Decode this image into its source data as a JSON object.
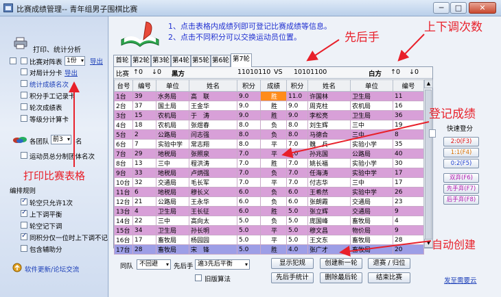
{
  "window": {
    "title": "比赛成绩管理-- 青年组男子围棋比赛",
    "minimize": "─",
    "maximize": "□",
    "close": "✕"
  },
  "sidebar": {
    "print_section_title": "打印、统计分析",
    "print_items": [
      {
        "label": "比赛对阵表",
        "checked": false,
        "copies": "1份",
        "action": "导出"
      },
      {
        "label": "对局计分卡",
        "checked": false,
        "action": "导出"
      },
      {
        "label": "统计成绩名次",
        "checked": false,
        "highlight": true
      },
      {
        "label": "积分手工记录卡",
        "checked": false
      },
      {
        "label": "轮次成绩表",
        "checked": false
      },
      {
        "label": "等级分计算卡",
        "checked": false
      }
    ],
    "team_label_before": "各团队",
    "team_select": "前3",
    "team_label_after": "名",
    "team_points_label": "运动员总分制团体名次",
    "rules_title": "编排规则",
    "rules": [
      {
        "label": "轮空只允许1次",
        "checked": true
      },
      {
        "label": "上下调平衡",
        "checked": true
      },
      {
        "label": "轮空记下调",
        "checked": false
      },
      {
        "label": "同积分仅一位时上下调不记",
        "checked": true
      },
      {
        "label": "包含辅助分",
        "checked": false
      }
    ],
    "update_link": "软件更新/论坛交流"
  },
  "instructions": {
    "line1": "1、点击表格内成绩列即可登记比赛成绩等信息。",
    "line2": "2、点击不同积分可以交换运动员位置。"
  },
  "annotations": {
    "order": "先后手",
    "updown": "上下调次数",
    "register": "登记成绩",
    "print": "打印比赛表格",
    "auto": "自动创建"
  },
  "tabs": [
    "首轮",
    "第2轮",
    "第3轮",
    "第4轮",
    "第5轮",
    "第6轮",
    "第7轮"
  ],
  "active_tab": "第7轮",
  "pair_bar": {
    "match_label": "比赛",
    "up_black": "↑0",
    "down_black": "↓0",
    "black_label": "黑方",
    "black_code": "11010110",
    "vs": "VS",
    "white_code": "10101100",
    "white_label": "白方",
    "up_white": "↑0",
    "down_white": "↓0"
  },
  "table": {
    "headers": [
      "台号",
      "编号",
      "单位",
      "姓名",
      "积分",
      "成绩",
      "积分",
      "姓名",
      "单位",
      "编号"
    ],
    "rows": [
      {
        "style": "pink",
        "cells": [
          "1台",
          "39",
          "水务局",
          "高　联",
          "9.0",
          "胜",
          "11.0",
          "许国林",
          "卫生局",
          "11"
        ],
        "hl": true
      },
      {
        "style": "white",
        "cells": [
          "2台",
          "37",
          "国土局",
          "王金华",
          "9.0",
          "胜",
          "9.0",
          "周克柱",
          "农机局",
          "16"
        ]
      },
      {
        "style": "pink",
        "cells": [
          "3台",
          "15",
          "农机局",
          "于　涛",
          "9.0",
          "胜",
          "9.0",
          "李松亮",
          "卫生局",
          "36"
        ]
      },
      {
        "style": "white",
        "cells": [
          "4台",
          "18",
          "农机局",
          "张煜春",
          "8.0",
          "负",
          "8.0",
          "刘生辉",
          "三中",
          "19"
        ]
      },
      {
        "style": "pink",
        "cells": [
          "5台",
          "2",
          "公路局",
          "闫志强",
          "8.0",
          "负",
          "8.0",
          "马德合",
          "三中",
          "8"
        ]
      },
      {
        "style": "white",
        "cells": [
          "6台",
          "7",
          "实验中学",
          "常志翔",
          "8.0",
          "平",
          "7.0",
          "魏　兵",
          "实验小学",
          "35"
        ]
      },
      {
        "style": "pink",
        "cells": [
          "7台",
          "29",
          "地税局",
          "张照泉",
          "7.0",
          "平",
          "7.0",
          "孙兆国",
          "公路局",
          "40"
        ]
      },
      {
        "style": "white",
        "cells": [
          "8台",
          "13",
          "三中",
          "程洪涛",
          "7.0",
          "胜",
          "7.0",
          "姚长福",
          "实验小学",
          "30"
        ]
      },
      {
        "style": "pink",
        "cells": [
          "9台",
          "33",
          "地税局",
          "卢炳强",
          "7.0",
          "负",
          "7.0",
          "任海涛",
          "实验中学",
          "17"
        ]
      },
      {
        "style": "white",
        "cells": [
          "10台",
          "32",
          "交通局",
          "毛长军",
          "7.0",
          "平",
          "7.0",
          "付志华",
          "三中",
          "17"
        ]
      },
      {
        "style": "pink",
        "cells": [
          "11台",
          "6",
          "地税局",
          "穆长义",
          "6.0",
          "负",
          "6.0",
          "王希然",
          "实验中学",
          "26"
        ]
      },
      {
        "style": "white",
        "cells": [
          "12台",
          "21",
          "公路局",
          "王永华",
          "6.0",
          "负",
          "6.0",
          "张朗霞",
          "交通局",
          "23"
        ]
      },
      {
        "style": "pink",
        "cells": [
          "13台",
          "4",
          "卫生局",
          "王长征",
          "6.0",
          "胜",
          "5.0",
          "张立辉",
          "交通局",
          "9"
        ]
      },
      {
        "style": "white",
        "cells": [
          "14台",
          "22",
          "三中",
          "高向太",
          "5.0",
          "负",
          "5.0",
          "庞国峰",
          "畜牧局",
          "4"
        ]
      },
      {
        "style": "pink",
        "cells": [
          "15台",
          "34",
          "卫生局",
          "孙长明",
          "5.0",
          "平",
          "5.0",
          "穆文昌",
          "物价局",
          "9"
        ]
      },
      {
        "style": "white",
        "cells": [
          "16台",
          "17",
          "畜牧局",
          "杨园园",
          "5.0",
          "平",
          "5.0",
          "王文东",
          "畜牧局",
          "28"
        ]
      },
      {
        "style": "selected",
        "cells": [
          "17台",
          "28",
          "畜牧局",
          "宋　锋",
          "5.0",
          "胜",
          "4.0",
          "张广才",
          "畜牧局",
          "20"
        ]
      }
    ]
  },
  "quick_register": {
    "title": "快速登分",
    "buttons": [
      "2:0(F3)",
      "1:1(F4)",
      "0:2(F5)",
      "双弃(F6)",
      "先手弃(F7)",
      "后手弃(F8)"
    ]
  },
  "bottom": {
    "same_team_label": "同队",
    "same_team_value": "不回避",
    "order_label": "先后手",
    "order_value": "遍3先后平衡",
    "old_algo_label": "旧版算法",
    "buttons": {
      "show_foul": "显示犯规",
      "create_round": "创建新一轮",
      "withdraw": "退赛 / 归位",
      "order_stats": "先后手统计",
      "delete_last": "删除最后轮",
      "end_match": "结束比赛"
    },
    "suggest_link": "发至需要云"
  }
}
